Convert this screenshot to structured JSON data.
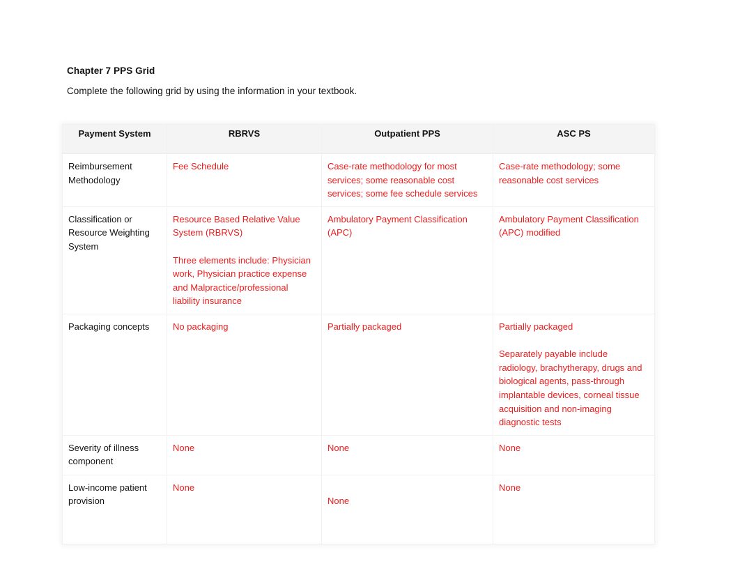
{
  "document": {
    "heading": "Chapter 7 PPS Grid",
    "intro": "Complete the following grid by using the information in your textbook."
  },
  "colors": {
    "answer_text": "#ee1c1c",
    "label_text": "#151515",
    "header_background": "#f4f4f4",
    "page_background": "#ffffff",
    "grid_border": "#f1f1f1"
  },
  "grid": {
    "headers": [
      "Payment System",
      "RBRVS",
      "Outpatient PPS",
      "ASC PS"
    ],
    "rows": [
      {
        "label": "Reimbursement Methodology",
        "rbrvs": [
          "Fee Schedule"
        ],
        "outpatient_pps": [
          "Case-rate methodology for most services; some reasonable cost services; some fee schedule services"
        ],
        "asc_ps": [
          "Case-rate methodology; some reasonable cost services"
        ]
      },
      {
        "label": "Classification or Resource Weighting System",
        "rbrvs": [
          "Resource Based Relative Value System (RBRVS)",
          "Three elements include: Physician work, Physician practice expense and Malpractice/professional liability insurance"
        ],
        "outpatient_pps": [
          "Ambulatory Payment Classification (APC)"
        ],
        "asc_ps": [
          "Ambulatory Payment Classification (APC) modified"
        ]
      },
      {
        "label": "Packaging concepts",
        "rbrvs": [
          "No packaging"
        ],
        "outpatient_pps": [
          "Partially packaged"
        ],
        "asc_ps": [
          "Partially packaged",
          "Separately payable include radiology, brachytherapy, drugs and biological agents, pass-through implantable devices, corneal tissue acquisition and non-imaging diagnostic tests"
        ]
      },
      {
        "label": "Severity of illness component",
        "rbrvs": [
          "None"
        ],
        "outpatient_pps": [
          "None"
        ],
        "asc_ps": [
          "None"
        ]
      },
      {
        "label": "Low-income patient provision",
        "rbrvs": [
          "None"
        ],
        "outpatient_pps": [
          "None"
        ],
        "outpatient_pps_offset": true,
        "asc_ps": [
          "None"
        ]
      }
    ]
  }
}
